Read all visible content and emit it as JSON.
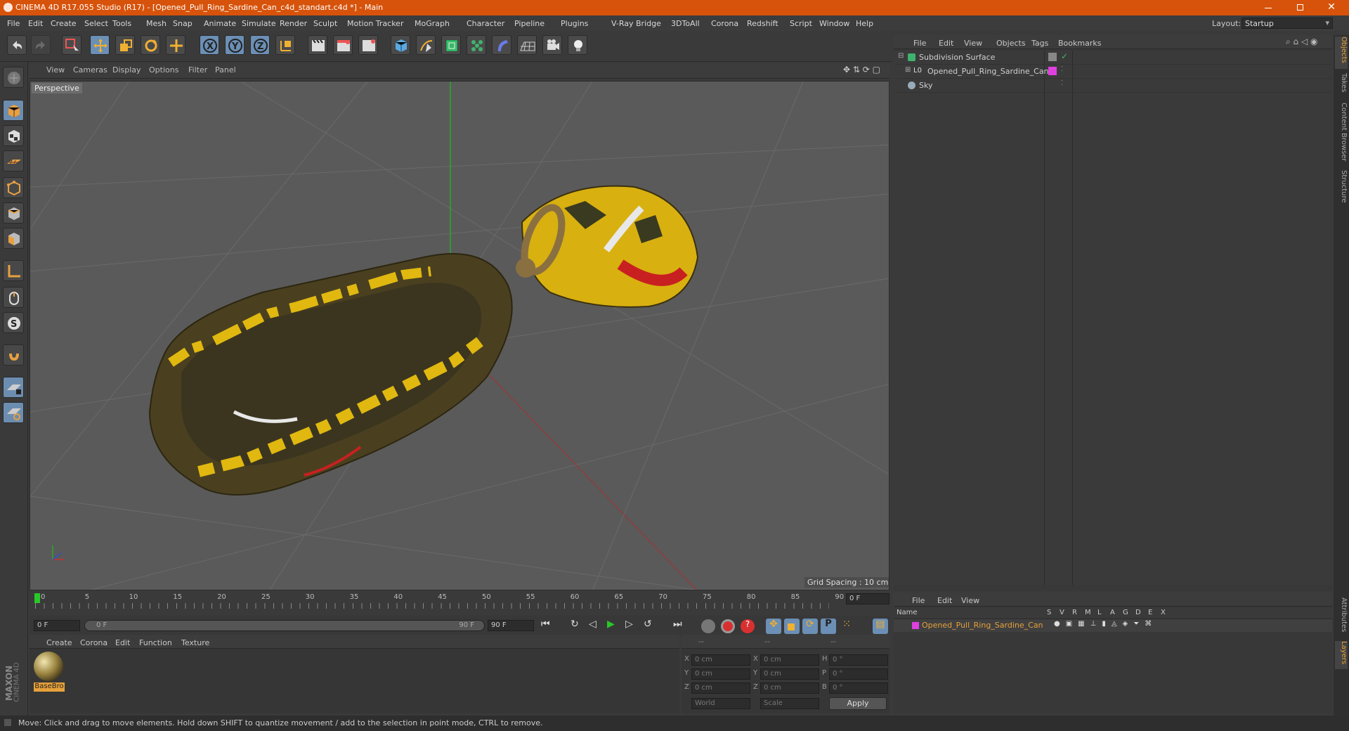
{
  "titlebar": {
    "title": "CINEMA 4D R17.055 Studio (R17) - [Opened_Pull_Ring_Sardine_Can_c4d_standart.c4d *] - Main"
  },
  "menubar": {
    "items": [
      "File",
      "Edit",
      "Create",
      "Select",
      "Tools",
      "Mesh",
      "Snap",
      "Animate",
      "Simulate",
      "Render",
      "Sculpt",
      "Motion Tracker",
      "MoGraph",
      "Character",
      "Pipeline",
      "Plugins",
      "V-Ray Bridge",
      "3DToAll",
      "Corona",
      "Redshift",
      "Script",
      "Window",
      "Help"
    ]
  },
  "layout": {
    "label": "Layout:",
    "value": "Startup"
  },
  "viewport": {
    "menu": [
      "View",
      "Cameras",
      "Display",
      "Options",
      "Filter",
      "Panel"
    ],
    "camera_label": "Perspective",
    "grid_spacing": "Grid Spacing : 10 cm"
  },
  "object_manager": {
    "menu": [
      "File",
      "Edit",
      "View",
      "Objects",
      "Tags",
      "Bookmarks"
    ],
    "objects": [
      {
        "name": "Subdivision Surface"
      },
      {
        "name": "Opened_Pull_Ring_Sardine_Can"
      },
      {
        "name": "Sky"
      }
    ]
  },
  "side_tabs": [
    "Objects",
    "Takes",
    "Content Browser",
    "Structure"
  ],
  "side_tabs_lower": [
    "Attributes",
    "Layers"
  ],
  "timeline": {
    "ticks": [
      "0",
      "5",
      "10",
      "15",
      "20",
      "25",
      "30",
      "35",
      "40",
      "45",
      "50",
      "55",
      "60",
      "65",
      "70",
      "75",
      "80",
      "85",
      "90"
    ],
    "end_field": "0 F"
  },
  "transport": {
    "start_field": "0 F",
    "range_start": "0 F",
    "range_end": "90 F",
    "end_field": "90 F"
  },
  "material_manager": {
    "menu": [
      "Create",
      "Corona",
      "Edit",
      "Function",
      "Texture"
    ],
    "material_name": "BaseBro"
  },
  "coordinates": {
    "headers": [
      "--",
      "--",
      "--"
    ],
    "rows": [
      {
        "axis": "X",
        "pos": "0 cm",
        "axis2": "X",
        "size": "0 cm",
        "axis3": "H",
        "rot": "0 °"
      },
      {
        "axis": "Y",
        "pos": "0 cm",
        "axis2": "Y",
        "size": "0 cm",
        "axis3": "P",
        "rot": "0 °"
      },
      {
        "axis": "Z",
        "pos": "0 cm",
        "axis2": "Z",
        "size": "0 cm",
        "axis3": "B",
        "rot": "0 °"
      }
    ],
    "mode1": "World",
    "mode2": "Scale",
    "apply": "Apply"
  },
  "layer_manager": {
    "menu": [
      "File",
      "Edit",
      "View"
    ],
    "name_header": "Name",
    "columns": [
      "S",
      "V",
      "R",
      "M",
      "L",
      "A",
      "G",
      "D",
      "E",
      "X"
    ],
    "layer_name": "Opened_Pull_Ring_Sardine_Can"
  },
  "statusbar": {
    "text": "Move: Click and drag to move elements. Hold down SHIFT to quantize movement / add to the selection in point mode, CTRL to remove."
  },
  "branding": {
    "line1": "MAXON",
    "line2": "CINEMA 4D"
  },
  "colors": {
    "titlebar": "#d7530b",
    "accent": "#e6a13a",
    "selected": "#6b8fb5",
    "layer_magenta": "#e040e0"
  }
}
